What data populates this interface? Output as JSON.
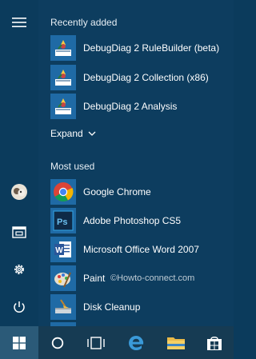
{
  "sidebar": {
    "items": [
      {
        "name": "menu-icon"
      },
      {
        "name": "user-avatar"
      },
      {
        "name": "file-explorer-icon"
      },
      {
        "name": "settings-icon"
      },
      {
        "name": "power-icon"
      }
    ]
  },
  "recently_added": {
    "header": "Recently added",
    "apps": [
      {
        "label": "DebugDiag 2 RuleBuilder (beta)",
        "icon": "debugdiag-icon"
      },
      {
        "label": "DebugDiag 2 Collection (x86)",
        "icon": "debugdiag-icon"
      },
      {
        "label": "DebugDiag 2 Analysis",
        "icon": "debugdiag-icon"
      }
    ],
    "expand_label": "Expand"
  },
  "most_used": {
    "header": "Most used",
    "apps": [
      {
        "label": "Google Chrome",
        "icon": "chrome-icon"
      },
      {
        "label": "Adobe Photoshop CS5",
        "icon": "photoshop-icon"
      },
      {
        "label": "Microsoft Office Word 2007",
        "icon": "word-icon"
      },
      {
        "label": "Paint",
        "icon": "paint-icon"
      },
      {
        "label": "Disk Cleanup",
        "icon": "disk-cleanup-icon"
      }
    ]
  },
  "watermark": "©Howto-connect.com",
  "taskbar": {
    "items": [
      "start-button",
      "cortana-button",
      "task-view-button",
      "edge-button",
      "file-explorer-button",
      "store-button"
    ]
  },
  "colors": {
    "background": "#0b3b5c",
    "taskbar": "#163b53",
    "tile_blue": "#1f6aa5"
  }
}
